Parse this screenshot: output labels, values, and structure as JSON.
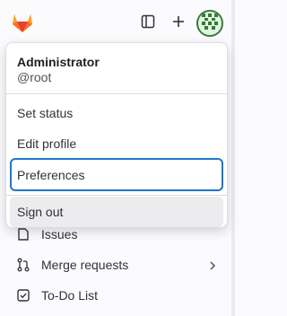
{
  "header": {
    "logo": "gitlab-tanuki-logo",
    "sidebar_toggle_icon": "sidebar-icon",
    "new_icon": "plus-icon",
    "avatar_icon": "user-avatar"
  },
  "user_menu": {
    "name": "Administrator",
    "handle": "@root",
    "items": [
      {
        "label": "Set status"
      },
      {
        "label": "Edit profile"
      },
      {
        "label": "Preferences",
        "state": "focused"
      },
      {
        "label": "Sign out",
        "state": "hovered"
      }
    ]
  },
  "nav": {
    "items": [
      {
        "label": "Issues",
        "icon": "issues-icon"
      },
      {
        "label": "Merge requests",
        "icon": "merge-request-icon",
        "has_submenu": true
      },
      {
        "label": "To-Do List",
        "icon": "todo-icon"
      }
    ]
  },
  "colors": {
    "accent": "#1f75cb",
    "logo_orange": "#fc6d26",
    "logo_red": "#e24329",
    "logo_yellow": "#fca326"
  }
}
